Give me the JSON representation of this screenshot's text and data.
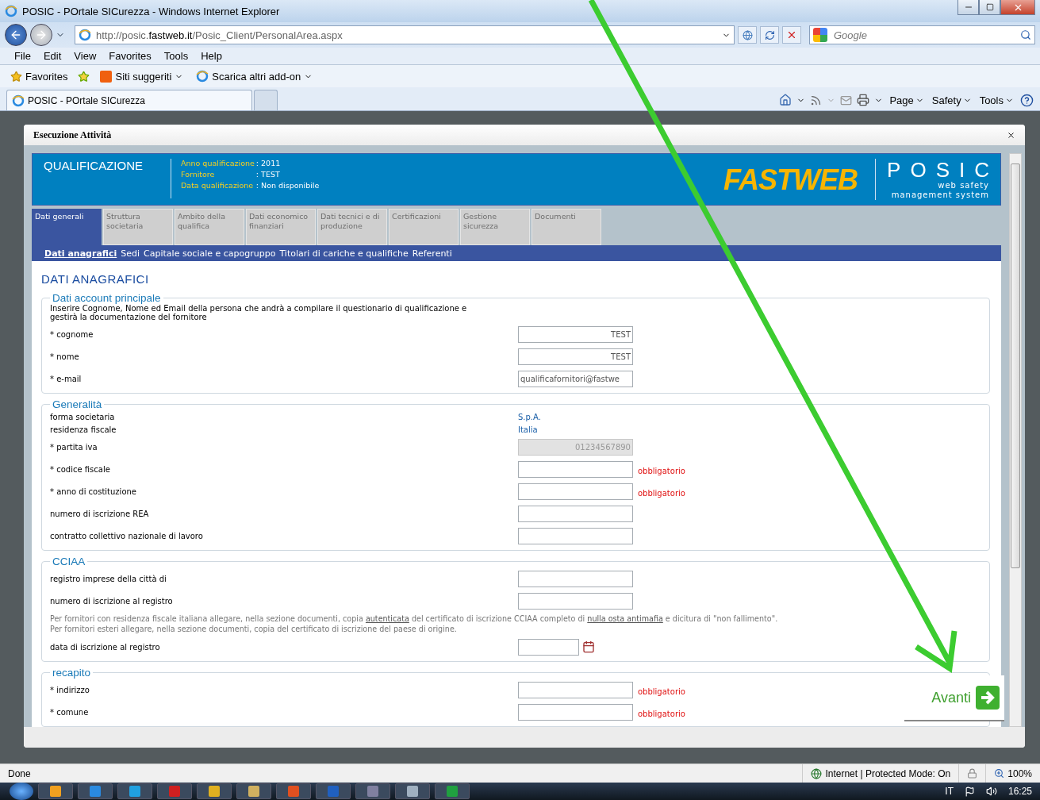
{
  "window": {
    "title": "POSIC - POrtale SICurezza - Windows Internet Explorer"
  },
  "address_bar": {
    "url": "http://posic.**fastweb.it**/Posic_Client/PersonalArea.aspx"
  },
  "search": {
    "placeholder": "Google"
  },
  "menu": [
    "File",
    "Edit",
    "View",
    "Favorites",
    "Tools",
    "Help"
  ],
  "favorites_bar": {
    "favorites": "Favorites",
    "items": [
      "Siti suggeriti",
      "Scarica altri add-on"
    ]
  },
  "browser_tabs": [
    {
      "label": "POSIC - POrtale SICurezza",
      "selected": true
    }
  ],
  "command_bar": [
    "Page",
    "Safety",
    "Tools"
  ],
  "dialog": {
    "title": "Esecuzione Attività",
    "header": {
      "title": "QUALIFICAZIONE",
      "info": [
        {
          "label": "Anno qualificazione",
          "value": ": 2011"
        },
        {
          "label": "Fornitore",
          "value": ": TEST"
        },
        {
          "label": "Data qualificazione",
          "value": ": Non disponibile"
        }
      ],
      "logo": "FASTWEB",
      "brand": "POSIC",
      "tagline": [
        "web safety",
        "management system"
      ]
    },
    "tabs": [
      {
        "label": "Dati generali",
        "selected": true
      },
      {
        "label": "Struttura societaria",
        "selected": false
      },
      {
        "label": "Ambito della qualifica",
        "selected": false
      },
      {
        "label": "Dati economico finanziari",
        "selected": false
      },
      {
        "label": "Dati tecnici e di produzione",
        "selected": false
      },
      {
        "label": "Certificazioni",
        "selected": false
      },
      {
        "label": "Gestione sicurezza",
        "selected": false
      },
      {
        "label": "Documenti",
        "selected": false
      }
    ],
    "subnav": [
      {
        "label": "Dati anagrafici",
        "selected": true
      },
      {
        "label": "Sedi",
        "selected": false
      },
      {
        "label": "Capitale sociale e capogruppo",
        "selected": false
      },
      {
        "label": "Titolari di cariche e qualifiche",
        "selected": false
      },
      {
        "label": "Referenti",
        "selected": false
      }
    ],
    "section_title": "DATI ANAGRAFICI",
    "fieldsets": [
      {
        "legend": "Dati account principale",
        "rows": [
          {
            "kind": "intro",
            "text": "Inserire Cognome, Nome ed Email della persona che andrà a compilare il questionario di qualificazione e gestirà la documentazione del fornitore"
          },
          {
            "kind": "text",
            "label": "* cognome",
            "value": "TEST",
            "right_aligned": true,
            "disabled": false
          },
          {
            "kind": "text",
            "label": "* nome",
            "value": "TEST",
            "right_aligned": true,
            "disabled": false
          },
          {
            "kind": "text",
            "label": "* e-mail",
            "value": "qualificafornitori@fastwe",
            "right_aligned": false,
            "disabled": false
          }
        ]
      },
      {
        "legend": "Generalità",
        "rows": [
          {
            "kind": "static",
            "label": "forma societaria",
            "value": "S.p.A."
          },
          {
            "kind": "static",
            "label": "residenza fiscale",
            "value": "Italia"
          },
          {
            "kind": "text",
            "label": "* partita iva",
            "value": "01234567890",
            "right_aligned": true,
            "disabled": true
          },
          {
            "kind": "text",
            "label": "* codice fiscale",
            "disabled": false,
            "error": "obbligatorio"
          },
          {
            "kind": "text",
            "label": "* anno di costituzione",
            "disabled": false,
            "error": "obbligatorio"
          },
          {
            "kind": "text",
            "label": "numero di iscrizione REA",
            "disabled": false
          },
          {
            "kind": "text",
            "label": "contratto collettivo nazionale di lavoro",
            "disabled": false
          }
        ]
      },
      {
        "legend": "CCIAA",
        "rows": [
          {
            "kind": "text",
            "label": "registro imprese della città di",
            "disabled": false
          },
          {
            "kind": "text",
            "label": "numero di iscrizione al registro",
            "disabled": false
          },
          {
            "kind": "note",
            "parts": [
              {
                "kind": "text",
                "text": "Per fornitori con residenza fiscale italiana allegare, nella sezione documenti, copia "
              },
              {
                "kind": "link",
                "text": "autenticata"
              },
              {
                "kind": "text",
                "text": " del certificato di iscrizione CCIAA completo di "
              },
              {
                "kind": "link",
                "text": "nulla osta antimafia"
              },
              {
                "kind": "text",
                "text": " e dicitura di \"non fallimento\". Per fornitori esteri allegare, nella sezione documenti, copia del certificato di iscrizione del paese di origine."
              }
            ]
          },
          {
            "kind": "date",
            "label": "data di iscrizione al registro",
            "disabled": false
          }
        ]
      },
      {
        "legend": "recapito",
        "rows": [
          {
            "kind": "text",
            "label": "* indirizzo",
            "disabled": false,
            "error": "obbligatorio"
          },
          {
            "kind": "text",
            "label": "* comune",
            "disabled": false,
            "error": "obbligatorio"
          }
        ]
      }
    ],
    "next_button": "Avanti"
  },
  "status_bar": {
    "status": "Done",
    "zone": "Internet | Protected Mode: On",
    "zoom": "100%"
  },
  "taskbar": {
    "language": "IT",
    "clock": "16:25"
  }
}
